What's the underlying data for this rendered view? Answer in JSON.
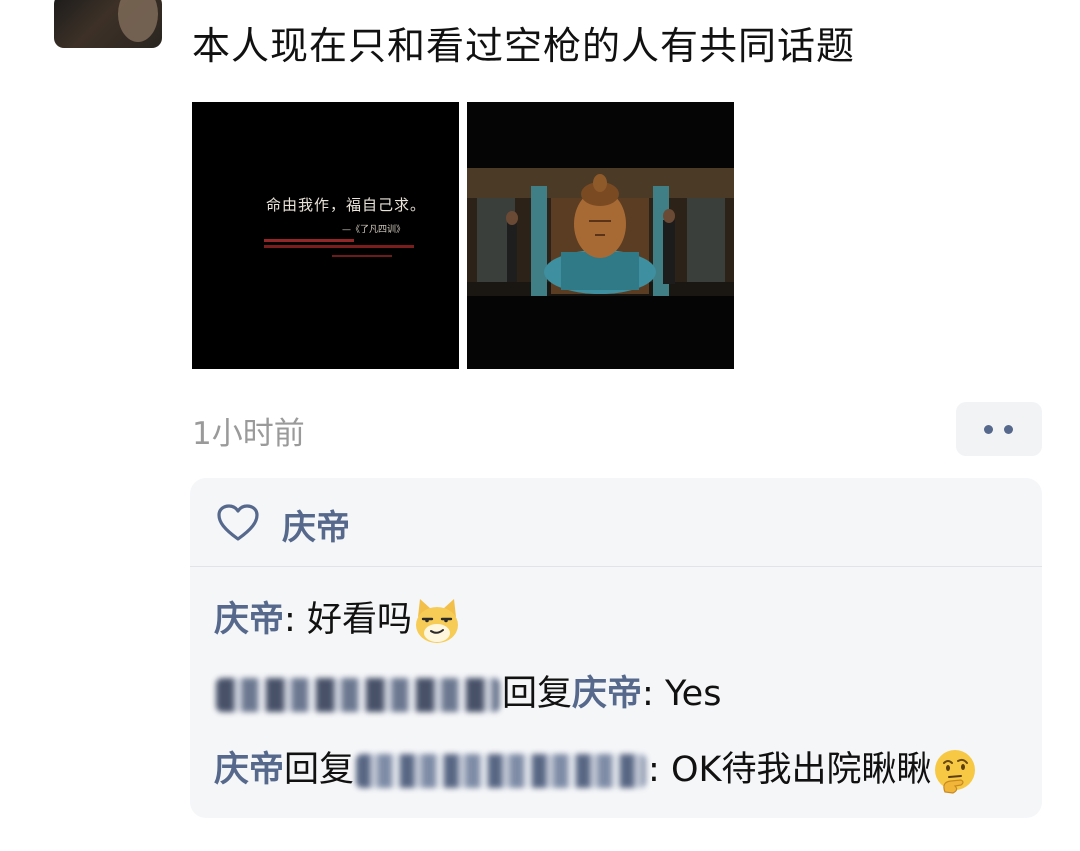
{
  "post": {
    "text": "本人现在只和看过空枪的人有共同话题",
    "timestamp": "1小时前"
  },
  "photos": [
    {
      "title": "命由我作，福自己求。",
      "subtitle": "—《了凡四训》"
    },
    {}
  ],
  "more_button": {
    "icon": "ellipsis-icon"
  },
  "likes": {
    "icon": "heart-outline-icon",
    "names": "庆帝"
  },
  "comments": [
    {
      "author": "庆帝",
      "separator": ": ",
      "text": "好看吗",
      "emoji": "smug-cat-emoji"
    },
    {
      "author_obscured": true,
      "reply_word": "回复",
      "reply_to": "庆帝",
      "separator": ": ",
      "text": "Yes"
    },
    {
      "author": "庆帝",
      "reply_word": "回复",
      "reply_to_obscured": true,
      "separator": ": ",
      "text": "OK待我出院瞅瞅",
      "emoji": "thinking-face-emoji"
    }
  ],
  "colors": {
    "name_blue": "#56698c",
    "timestamp_gray": "#9a9a9a",
    "comment_bg": "#f5f6f8"
  }
}
